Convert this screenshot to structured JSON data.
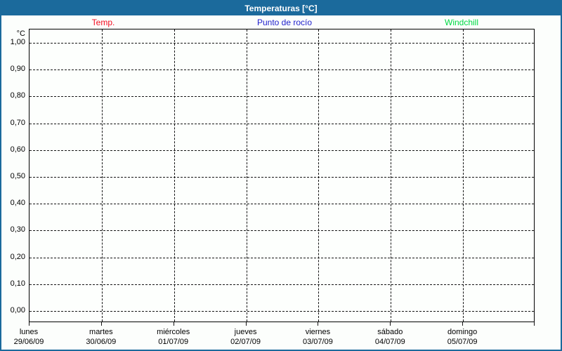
{
  "window": {
    "title": "Temperaturas [°C]"
  },
  "legend": {
    "items": [
      {
        "label": "Temp.",
        "color": "#f30e22"
      },
      {
        "label": "Punto de rocío",
        "color": "#2121cc"
      },
      {
        "label": "Windchill",
        "color": "#00d944"
      }
    ]
  },
  "chart_data": {
    "type": "line",
    "title": "Temperaturas [°C]",
    "ylabel": "°C",
    "ylim": [
      0.0,
      1.0
    ],
    "y_tick_step": 0.1,
    "y_tick_labels": [
      "1,00",
      "0,90",
      "0,80",
      "0,70",
      "0,60",
      "0,50",
      "0,40",
      "0,30",
      "0,20",
      "0,10",
      "0,00"
    ],
    "grid": true,
    "legend_position": "top",
    "series": [
      {
        "name": "Temp.",
        "color": "#f30e22",
        "values": []
      },
      {
        "name": "Punto de rocío",
        "color": "#2121cc",
        "values": []
      },
      {
        "name": "Windchill",
        "color": "#00d944",
        "values": []
      }
    ],
    "x_days": [
      {
        "day": "lunes",
        "date": "29/06/09"
      },
      {
        "day": "martes",
        "date": "30/06/09"
      },
      {
        "day": "miércoles",
        "date": "01/07/09"
      },
      {
        "day": "jueves",
        "date": "02/07/09"
      },
      {
        "day": "viernes",
        "date": "03/07/09"
      },
      {
        "day": "sábado",
        "date": "04/07/09"
      },
      {
        "day": "domingo",
        "date": "05/07/09"
      }
    ]
  }
}
